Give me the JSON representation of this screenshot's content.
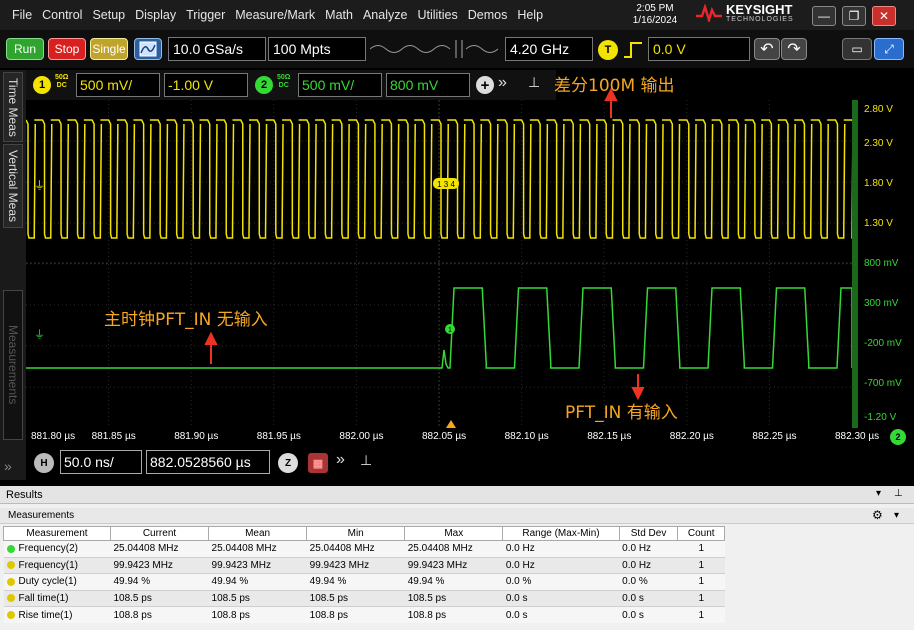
{
  "menu": [
    "File",
    "Control",
    "Setup",
    "Display",
    "Trigger",
    "Measure/Mark",
    "Math",
    "Analyze",
    "Utilities",
    "Demos",
    "Help"
  ],
  "clock": {
    "time": "2:05 PM",
    "date": "1/16/2024"
  },
  "brand": {
    "name": "KEYSIGHT",
    "sub": "TECHNOLOGIES"
  },
  "controls": {
    "run": "Run",
    "stop": "Stop",
    "single": "Single"
  },
  "acquisition": {
    "sample_rate": "10.0 GSa/s",
    "memory": "100 Mpts",
    "bandwidth": "4.20 GHz",
    "trigger_label": "T",
    "trigger_level": "0.0 V"
  },
  "channels": [
    {
      "num": "1",
      "imp_top": "50Ω",
      "imp_bot": "DC",
      "scale": "500 mV/",
      "offset": "-1.00 V",
      "color": "#f2e400"
    },
    {
      "num": "2",
      "imp_top": "50Ω",
      "imp_bot": "DC",
      "scale": "500 mV/",
      "offset": "800 mV",
      "color": "#35d935"
    }
  ],
  "side_tabs": [
    "Time Meas",
    "Vertical Meas",
    "Measurements"
  ],
  "trigger_marker": "1 3 4",
  "right_scale": {
    "ch1": [
      "2.80 V",
      "2.30 V",
      "1.80 V",
      "1.30 V"
    ],
    "ch2": [
      "800 mV",
      "300 mV",
      "-200 mV",
      "-700 mV",
      "-1.20 V"
    ]
  },
  "time_ticks": [
    "881.80 µs",
    "881.85 µs",
    "881.90 µs",
    "881.95 µs",
    "882.00 µs",
    "882.05 µs",
    "882.10 µs",
    "882.15 µs",
    "882.20 µs",
    "882.25 µs",
    "882.30 µs"
  ],
  "timebase": {
    "h_label": "H",
    "scale": "50.0 ns/",
    "position": "882.0528560 µs"
  },
  "annotations": {
    "diff": "差分100M 输出",
    "no_input": "主时钟PFT_IN 无输入",
    "has_input": "PFT_IN 有输入"
  },
  "results": {
    "title": "Results",
    "panel": "Measurements",
    "columns": [
      "Measurement",
      "Current",
      "Mean",
      "Min",
      "Max",
      "Range (Max-Min)",
      "Std Dev",
      "Count"
    ],
    "rows": [
      {
        "name": "Frequency(2)",
        "current": "25.04408 MHz",
        "mean": "25.04408 MHz",
        "min": "25.04408 MHz",
        "max": "25.04408 MHz",
        "range": "0.0 Hz",
        "std": "0.0 Hz",
        "count": "1",
        "color": "#35d935"
      },
      {
        "name": "Frequency(1)",
        "current": "99.9423 MHz",
        "mean": "99.9423 MHz",
        "min": "99.9423 MHz",
        "max": "99.9423 MHz",
        "range": "0.0 Hz",
        "std": "0.0 Hz",
        "count": "1",
        "color": "#e0c800"
      },
      {
        "name": "Duty cycle(1)",
        "current": "49.94 %",
        "mean": "49.94 %",
        "min": "49.94 %",
        "max": "49.94 %",
        "range": "0.0 %",
        "std": "0.0 %",
        "count": "1",
        "color": "#e0c800"
      },
      {
        "name": "Fall time(1)",
        "current": "108.5 ps",
        "mean": "108.5 ps",
        "min": "108.5 ps",
        "max": "108.5 ps",
        "range": "0.0 s",
        "std": "0.0 s",
        "count": "1",
        "color": "#e0c800"
      },
      {
        "name": "Rise time(1)",
        "current": "108.8 ps",
        "mean": "108.8 ps",
        "min": "108.8 ps",
        "max": "108.8 ps",
        "range": "0.0 s",
        "std": "0.0 s",
        "count": "1",
        "color": "#e0c800"
      }
    ]
  }
}
